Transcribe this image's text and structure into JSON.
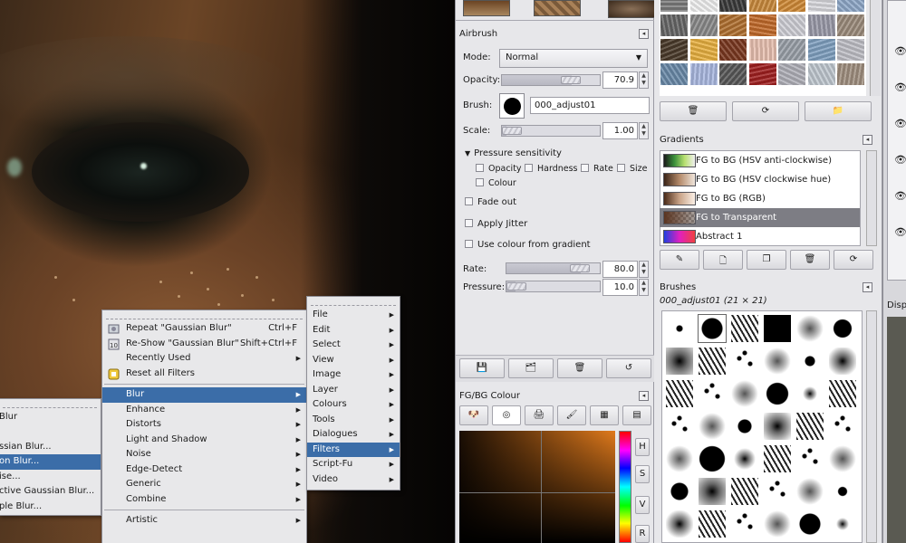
{
  "left_menu": {
    "items": [
      {
        "label": "Blur",
        "highlight": false
      },
      {
        "label": "ssian Blur...",
        "highlight": false
      },
      {
        "label": "on Blur...",
        "highlight": true
      },
      {
        "label": "ise...",
        "highlight": false
      },
      {
        "label": "ctive Gaussian Blur...",
        "highlight": false
      },
      {
        "label": "ple Blur...",
        "highlight": false
      }
    ]
  },
  "filters_menu": {
    "top_items": [
      {
        "label": "Repeat \"Gaussian Blur\"",
        "accel": "Ctrl+F",
        "icon": "repeat-icon"
      },
      {
        "label": "Re-Show \"Gaussian Blur\"",
        "accel": "Shift+Ctrl+F",
        "icon": "reshow-icon"
      },
      {
        "label": "Recently Used",
        "accel": "",
        "icon": "",
        "submenu": true
      },
      {
        "label": "Reset all Filters",
        "accel": "",
        "icon": "reset-icon"
      }
    ],
    "groups": [
      {
        "label": "Blur",
        "highlight": true
      },
      {
        "label": "Enhance"
      },
      {
        "label": "Distorts"
      },
      {
        "label": "Light and Shadow"
      },
      {
        "label": "Noise"
      },
      {
        "label": "Edge-Detect"
      },
      {
        "label": "Generic"
      },
      {
        "label": "Combine"
      }
    ],
    "bottom": [
      {
        "label": "Artistic"
      }
    ]
  },
  "main_menu": {
    "items": [
      {
        "label": "File"
      },
      {
        "label": "Edit"
      },
      {
        "label": "Select"
      },
      {
        "label": "View"
      },
      {
        "label": "Image"
      },
      {
        "label": "Layer"
      },
      {
        "label": "Colours"
      },
      {
        "label": "Tools"
      },
      {
        "label": "Dialogues"
      },
      {
        "label": "Filters",
        "highlight": true
      },
      {
        "label": "Script-Fu"
      },
      {
        "label": "Video"
      }
    ]
  },
  "airbrush": {
    "title": "Airbrush",
    "mode_label": "Mode:",
    "mode_value": "Normal",
    "opacity_label": "Opacity:",
    "opacity_value": "70.9",
    "opacity_fraction": 0.709,
    "brush_label": "Brush:",
    "brush_name": "000_adjust01",
    "scale_label": "Scale:",
    "scale_value": "1.00",
    "pressure_header": "Pressure sensitivity",
    "pressure_opacity": "Opacity",
    "pressure_hardness": "Hardness",
    "pressure_rate": "Rate",
    "pressure_size": "Size",
    "pressure_colour": "Colour",
    "fade_out": "Fade out",
    "apply_jitter": "Apply Jitter",
    "use_colour_gradient": "Use colour from gradient",
    "rate_label": "Rate:",
    "rate_value": "80.0",
    "rate_fraction": 0.8,
    "pressure_label": "Pressure:",
    "pressure_value": "10.0",
    "pressure_fraction": 0.1
  },
  "fgbg": {
    "title": "FG/BG Colour",
    "channel_h": "H",
    "channel_s": "S",
    "channel_v": "V",
    "channel_r": "R"
  },
  "gradients": {
    "title": "Gradients",
    "items": [
      {
        "label": "FG to BG (HSV anti-clockwise)",
        "highlight": false
      },
      {
        "label": "FG to BG (HSV clockwise hue)",
        "highlight": false
      },
      {
        "label": "FG to BG (RGB)",
        "highlight": false
      },
      {
        "label": "FG to Transparent",
        "highlight": true
      },
      {
        "label": "Abstract 1",
        "highlight": false
      }
    ]
  },
  "brushes": {
    "title": "Brushes",
    "current": "000_adjust01 (21 × 21)"
  },
  "right_edge": {
    "disp_label": "Displ"
  },
  "colors": {
    "menu_highlight": "#3b6da8",
    "panel_bg": "#e7e7ea",
    "list_highlight": "#7d7d84"
  }
}
